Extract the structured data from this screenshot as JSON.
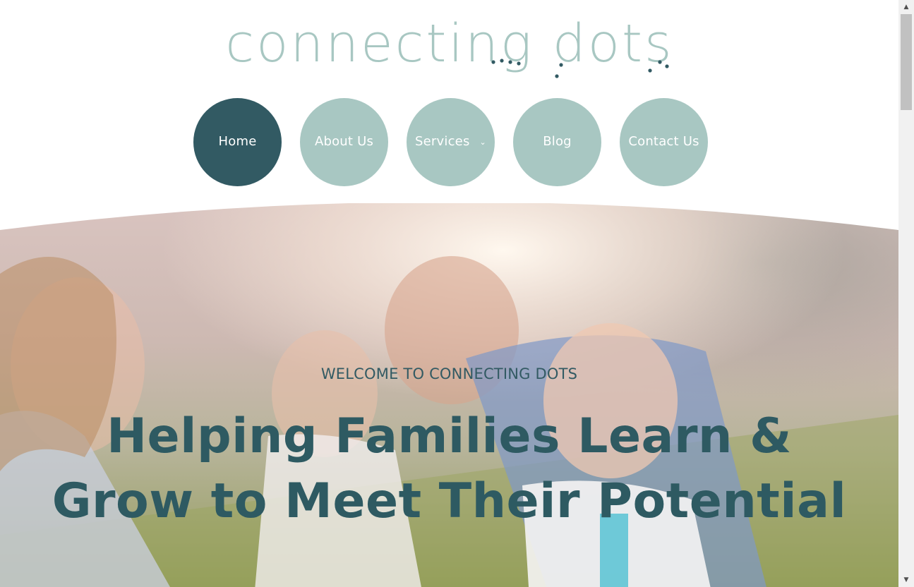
{
  "logo": {
    "text": "connecting dots",
    "color": "#a8c7c2",
    "dot_color": "#325a63"
  },
  "nav": {
    "items": [
      {
        "label": "Home",
        "active": true
      },
      {
        "label": "About Us",
        "active": false
      },
      {
        "label": "Services",
        "active": false,
        "caret": "⌄"
      },
      {
        "label": "Blog",
        "active": false
      },
      {
        "label": "Contact Us",
        "active": false
      }
    ],
    "colors": {
      "active": "#325a63",
      "inactive": "#a8c7c2",
      "text": "#ffffff"
    }
  },
  "hero": {
    "kicker": "WELCOME TO CONNECTING DOTS",
    "headline_line1": "Helping Families Learn &",
    "headline_line2": "Grow to Meet Their Potential",
    "text_color": "#2e5a62",
    "image": "family-outdoors-photo"
  },
  "scrollbar": {
    "up_icon": "▲",
    "down_icon": "▼"
  }
}
